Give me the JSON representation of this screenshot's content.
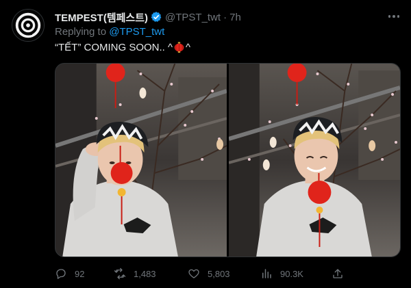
{
  "author": {
    "display_name": "TEMPEST(템페스트)",
    "handle": "@TPST_twt",
    "time": "7h",
    "verified": true
  },
  "replying": {
    "prefix": "Replying to ",
    "mention": "@TPST_twt"
  },
  "tweet": {
    "text_before": "“TẾT” COMING SOON.. ^",
    "emoji_icon": "red-lantern-emoji-icon",
    "text_after": "^"
  },
  "media": {
    "photos": [
      "photo-1",
      "photo-2"
    ]
  },
  "actions": {
    "reply_count": "92",
    "retweet_count": "1,483",
    "like_count": "5,803",
    "views_count": "90.3K"
  },
  "colors": {
    "background": "#000000",
    "text": "#e7e9ea",
    "muted": "#71767b",
    "link": "#1d9bf0",
    "lantern_red": "#e0241b"
  }
}
